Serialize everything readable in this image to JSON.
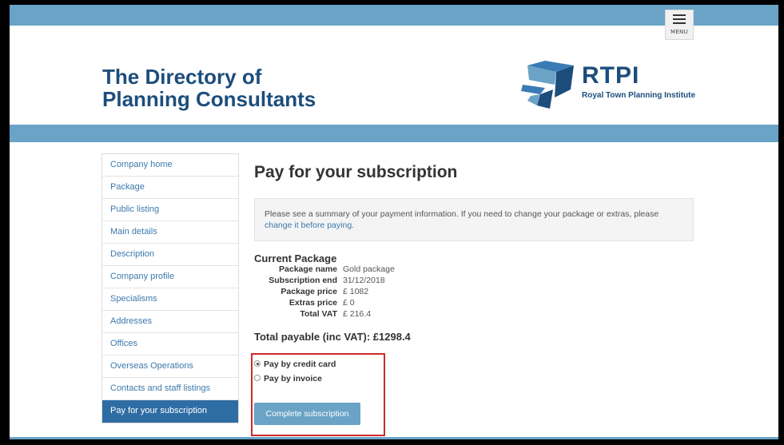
{
  "header": {
    "menu_label": "MENU",
    "site_title_line1": "The Directory of",
    "site_title_line2": "Planning Consultants",
    "logo_main": "RTPI",
    "logo_sub": "Royal Town Planning Institute",
    "brand_color": "#1d4d7c",
    "band_color": "#6aa3c6"
  },
  "sidebar": {
    "items": [
      {
        "label": "Company home"
      },
      {
        "label": "Package"
      },
      {
        "label": "Public listing"
      },
      {
        "label": "Main details"
      },
      {
        "label": "Description"
      },
      {
        "label": "Company profile"
      },
      {
        "label": "Specialisms"
      },
      {
        "label": "Addresses"
      },
      {
        "label": "Offices"
      },
      {
        "label": "Overseas Operations"
      },
      {
        "label": "Contacts and staff listings"
      },
      {
        "label": "Pay for your subscription",
        "active": true
      }
    ]
  },
  "main": {
    "heading": "Pay for your subscription",
    "notice_text": "Please see a summary of your payment information. If you need to change your package or extras, please",
    "notice_link": "change it before paying.",
    "package_title": "Current Package",
    "package": [
      {
        "key": "Package name",
        "value": "Gold package"
      },
      {
        "key": "Subscription end",
        "value": "31/12/2018"
      },
      {
        "key": "Package price",
        "value": "£ 1082"
      },
      {
        "key": "Extras price",
        "value": "£ 0"
      },
      {
        "key": "Total VAT",
        "value": "£ 216.4"
      }
    ],
    "total_payable": "Total payable (inc VAT): £1298.4",
    "payment_options": [
      {
        "label": "Pay by credit card",
        "checked": true
      },
      {
        "label": "Pay by invoice",
        "checked": false
      }
    ],
    "submit_label": "Complete subscription"
  }
}
